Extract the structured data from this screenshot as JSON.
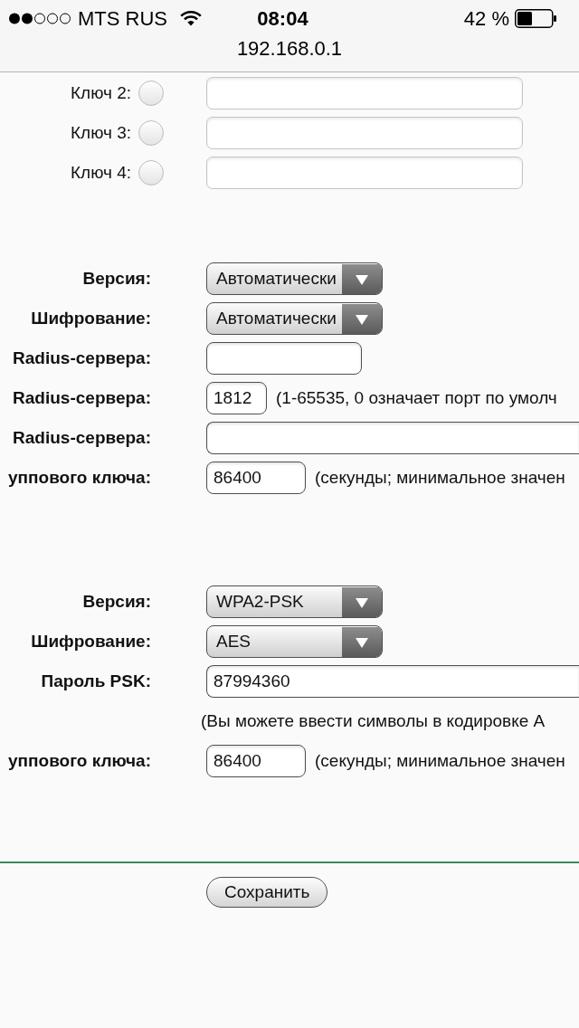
{
  "status_bar": {
    "carrier": "MTS RUS",
    "time": "08:04",
    "battery": "42 %"
  },
  "address_bar": {
    "url": "192.168.0.1"
  },
  "wep_keys": [
    {
      "label": "Ключ 2:",
      "selected": false,
      "disabled": true
    },
    {
      "label": "Ключ 3:",
      "selected": false,
      "disabled": true
    },
    {
      "label": "Ключ 4:",
      "selected": false,
      "disabled": true
    }
  ],
  "sections": [
    {
      "fields": [
        {
          "kind": "select",
          "label": "Версия:",
          "value": "Автоматически"
        },
        {
          "kind": "select",
          "label": "Шифрование:",
          "value": "Автоматически"
        },
        {
          "kind": "address",
          "label": "Radius-сервера:"
        },
        {
          "kind": "port",
          "label": "Radius-сервера:",
          "value": "1812",
          "hint": "(1-65535, 0 означает порт по умолч"
        },
        {
          "kind": "secret",
          "label": "Radius-сервера:"
        },
        {
          "kind": "period",
          "label": "уппового ключа:",
          "value": "86400",
          "hint": "(секунды; минимальное значен"
        }
      ]
    },
    {
      "fields": [
        {
          "kind": "select",
          "label": "Версия:",
          "value": "WPA2-PSK"
        },
        {
          "kind": "select",
          "label": "Шифрование:",
          "value": "AES"
        },
        {
          "kind": "secret",
          "label": "Пароль PSK:",
          "value": "87994360"
        },
        {
          "kind": "note",
          "text": "(Вы можете ввести символы в кодировке A"
        },
        {
          "kind": "period",
          "label": "уппового ключа:",
          "value": "86400",
          "hint": "(секунды; минимальное значен"
        }
      ]
    }
  ],
  "save_button": "Сохранить"
}
